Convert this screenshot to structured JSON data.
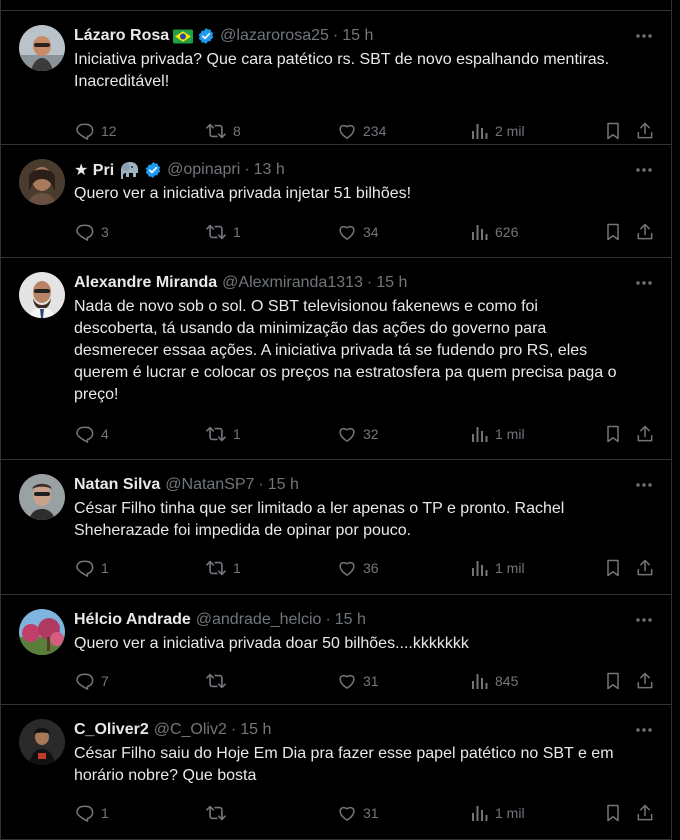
{
  "colors": {
    "background": "#000000",
    "text": "#e7e9ea",
    "secondary": "#71767b",
    "border": "#2f3336",
    "verified": "#1d9bf0"
  },
  "tweets": [
    {
      "name": "Lázaro Rosa",
      "emoji": "brazil-flag-icon",
      "verified": true,
      "handle": "@lazarorosa25",
      "time": "15 h",
      "text": "Iniciativa privada? Que cara patético rs. SBT de novo espalhando mentiras.\nInacreditável!",
      "replies": "12",
      "retweets": "8",
      "likes": "234",
      "views": "2 mil"
    },
    {
      "name": "★ Pri",
      "emoji": "elephant-icon",
      "verified": true,
      "handle": "@opinapri",
      "time": "13 h",
      "text": "Quero ver a iniciativa privada injetar 51 bilhões!",
      "replies": "3",
      "retweets": "1",
      "likes": "34",
      "views": "626"
    },
    {
      "name": "Alexandre Miranda",
      "verified": false,
      "handle": "@Alexmiranda1313",
      "time": "15 h",
      "text": "Nada de novo sob o sol. O SBT televisionou fakenews e como foi\ndescoberta, tá usando da minimização das ações do governo para\ndesmerecer essaa ações. A iniciativa privada tá se fudendo pro RS, eles\nquerem é lucrar e colocar os preços na estratosfera pa quem precisa paga o\npreço!",
      "replies": "4",
      "retweets": "1",
      "likes": "32",
      "views": "1 mil"
    },
    {
      "name": "Natan Silva",
      "verified": false,
      "handle": "@NatanSP7",
      "time": "15 h",
      "text": "César Filho tinha que ser limitado a ler apenas o TP e pronto. Rachel\nSheherazade foi impedida de opinar por pouco.",
      "replies": "1",
      "retweets": "1",
      "likes": "36",
      "views": "1 mil"
    },
    {
      "name": "Hélcio Andrade",
      "verified": false,
      "handle": "@andrade_helcio",
      "time": "15 h",
      "text": "Quero ver a iniciativa privada doar 50 bilhões....kkkkkkk",
      "replies": "7",
      "retweets": "",
      "likes": "31",
      "views": "845"
    },
    {
      "name": "C_Oliver2",
      "verified": false,
      "handle": "@C_Oliv2",
      "time": "15 h",
      "text": "César Filho saiu do Hoje Em Dia pra fazer esse papel patético no SBT e em\nhorário nobre? Que bosta",
      "replies": "1",
      "retweets": "",
      "likes": "31",
      "views": "1 mil"
    }
  ]
}
